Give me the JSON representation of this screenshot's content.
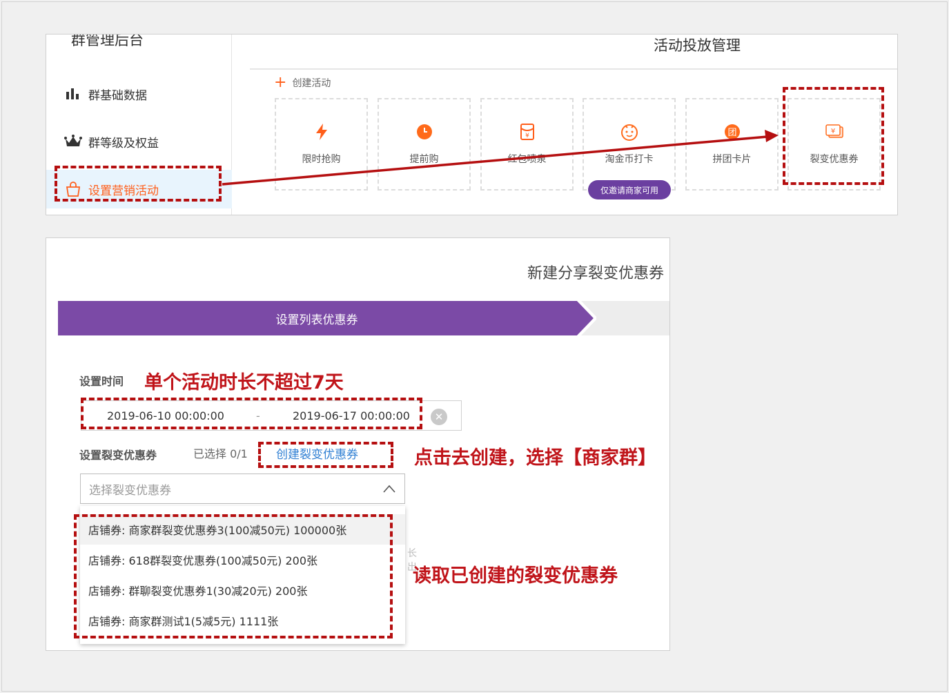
{
  "sidebar": {
    "title": "群管理后台",
    "items": [
      {
        "label": "群基础数据",
        "icon": "bar-chart-icon"
      },
      {
        "label": "群等级及权益",
        "icon": "crown-icon"
      },
      {
        "label": "设置营销活动",
        "icon": "shopping-bag-icon",
        "active": true
      }
    ]
  },
  "main": {
    "title": "活动投放管理",
    "create_label": "创建活动",
    "cards": [
      {
        "label": "限时抢购",
        "icon": "lightning-icon"
      },
      {
        "label": "提前购",
        "icon": "clock-icon"
      },
      {
        "label": "红包喷泉",
        "icon": "red-envelope-icon"
      },
      {
        "label": "淘金币打卡",
        "icon": "coin-face-icon",
        "badge": "仅邀请商家可用"
      },
      {
        "label": "拼团卡片",
        "icon": "group-buy-icon",
        "icon_text": "团"
      },
      {
        "label": "裂变优惠券",
        "icon": "coupon-icon",
        "icon_text": "¥"
      }
    ]
  },
  "form": {
    "title": "新建分享裂变优惠券",
    "step_label": "设置列表优惠券",
    "time_label": "设置时间",
    "start_time": "2019-06-10 00:00:00",
    "separator": "-",
    "end_time": "2019-06-17 00:00:00",
    "coupon_label": "设置裂变优惠券",
    "selected_count": "已选择 0/1",
    "create_coupon_link": "创建裂变优惠券",
    "select_placeholder": "选择裂变优惠券",
    "options": [
      "店铺券: 商家群裂变优惠券3(100减50元) 100000张",
      "店铺券: 618群裂变优惠券(100减50元) 200张",
      "店铺券: 群聊裂变优惠券1(30减20元) 200张",
      "店铺券: 商家群测试1(5减5元) 1111张"
    ]
  },
  "annotations": {
    "time_note": "单个活动时长不超过7天",
    "create_note": "点击去创建，选择【商家群】",
    "read_note": "读取已创建的裂变优惠券"
  },
  "colors": {
    "accent_orange": "#ff5e1a",
    "purple": "#7b4aa6",
    "annotation_red": "#b50f10",
    "link_blue": "#2f7fd3"
  }
}
